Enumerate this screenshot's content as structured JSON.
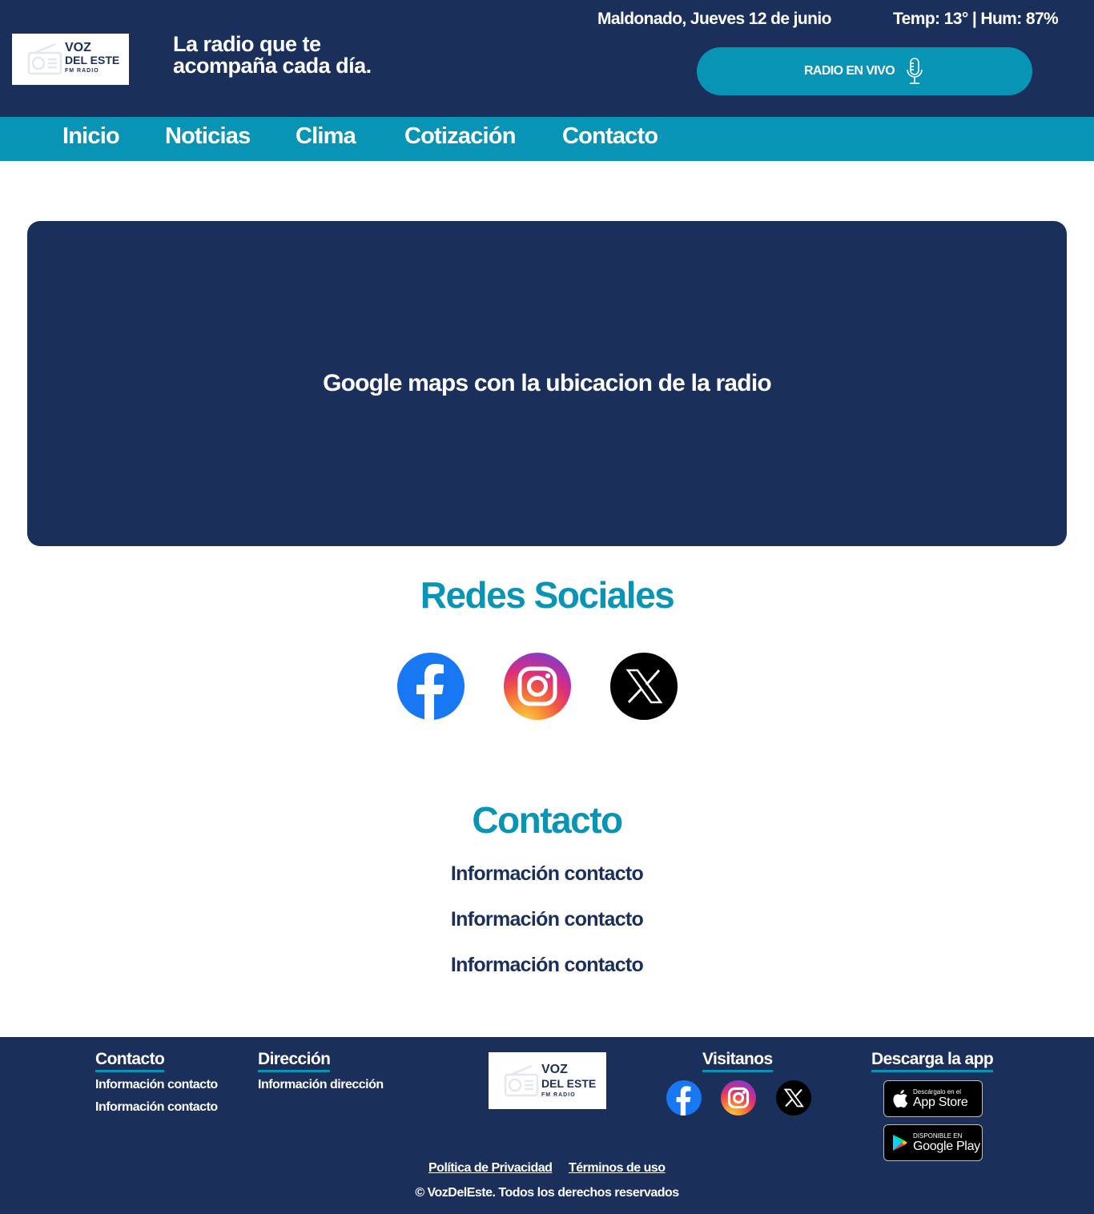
{
  "header": {
    "logo": {
      "line1": "VOZ",
      "line2": "DEL ESTE",
      "line3": "FM RADIO"
    },
    "tagline": "La radio que te acompaña cada día.",
    "date": "Maldonado, Jueves 12 de junio",
    "weather": "Temp: 13° | Hum: 87%",
    "live_button": "RADIO EN VIVO"
  },
  "nav": {
    "items": [
      {
        "label": "Inicio"
      },
      {
        "label": "Noticias"
      },
      {
        "label": "Clima"
      },
      {
        "label": "Cotización"
      },
      {
        "label": "Contacto"
      }
    ]
  },
  "map": {
    "placeholder": "Google maps con la ubicacion de la radio"
  },
  "social": {
    "title": "Redes Sociales",
    "icons": [
      "facebook-icon",
      "instagram-icon",
      "x-icon"
    ]
  },
  "contact": {
    "title": "Contacto",
    "items": [
      "Información contacto",
      "Información contacto",
      "Información contacto"
    ]
  },
  "footer": {
    "contact": {
      "title": "Contacto",
      "items": [
        "Información contacto",
        "Información contacto"
      ]
    },
    "address": {
      "title": "Dirección",
      "items": [
        "Información dirección"
      ]
    },
    "visit": {
      "title": "Visitanos"
    },
    "app": {
      "title": "Descarga la app",
      "appstore": {
        "small": "Descárgalo en el",
        "big": "App Store"
      },
      "googleplay": {
        "small": "DISPONIBLE EN",
        "big": "Google Play"
      }
    },
    "privacy": "Política de Privacidad",
    "terms": "Términos de uso",
    "copyright": "© VozDelEste. Todos los derechos reservados"
  },
  "colors": {
    "navy": "#1b2f5b",
    "accent": "#0895b5",
    "facebook": "#1877f2"
  }
}
